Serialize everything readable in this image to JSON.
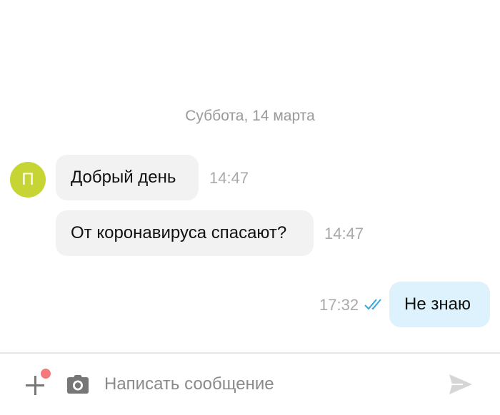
{
  "chat": {
    "date_separator": "Суббота, 14 марта",
    "avatar_letter": "П",
    "messages": [
      {
        "direction": "incoming",
        "text": "Добрый день",
        "time": "14:47"
      },
      {
        "direction": "incoming",
        "text": "От коронавируса спасают?",
        "time": "14:47"
      },
      {
        "direction": "outgoing",
        "text": "Не знаю",
        "time": "17:32",
        "status": "read"
      }
    ]
  },
  "composer": {
    "placeholder": "Написать сообщение",
    "value": "",
    "icons": {
      "attach": "plus-icon",
      "camera": "camera-icon",
      "send": "send-icon"
    }
  },
  "colors": {
    "avatar_bg": "#c6d534",
    "incoming_bubble": "#f2f2f2",
    "outgoing_bubble": "#ddf2fc",
    "read_ticks": "#3aa6d9",
    "notification_dot": "#f27a7a"
  }
}
